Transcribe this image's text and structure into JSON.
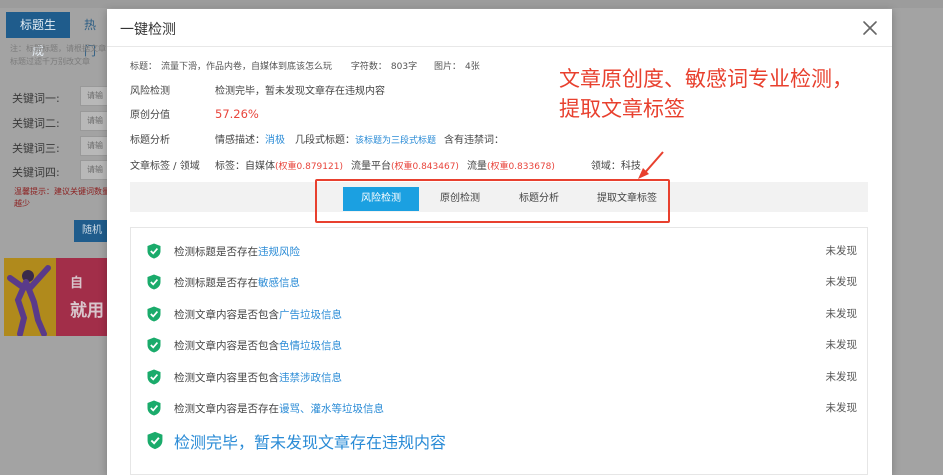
{
  "background": {
    "tabs": [
      "标题生成",
      "热门"
    ],
    "note": "注：标题标题，请根据文章标题过滤千万别改文章",
    "keywords": [
      {
        "label": "关键词一:",
        "placeholder": "请输"
      },
      {
        "label": "关键词二:",
        "placeholder": "请输"
      },
      {
        "label": "关键词三:",
        "placeholder": "请输"
      },
      {
        "label": "关键词四:",
        "placeholder": "请输"
      }
    ],
    "warning": "温馨提示：建议关键词数量越少",
    "random_button": "随机",
    "banner_lines": [
      "自",
      "就用"
    ]
  },
  "modal": {
    "title": "一键检测",
    "meta": {
      "title_label": "标题：",
      "title_value": "流量下滑，作品内卷，自媒体到底该怎么玩",
      "chars_label": "字符数：",
      "chars_value": "803字",
      "images_label": "图片：",
      "images_value": "4张"
    },
    "risk": {
      "label": "风险检测",
      "value": "检测完毕，暂未发现文章存在违规内容"
    },
    "originality": {
      "label": "原创分值",
      "value": "57.26%"
    },
    "title_analysis": {
      "label": "标题分析",
      "sentiment_label": "情感描述：",
      "sentiment_value": "消极",
      "segment_label": "几段式标题：",
      "segment_value": "该标题为三段式标题",
      "banned_label": "含有违禁词："
    },
    "tags": {
      "label": "文章标签 / 领域",
      "tag_label": "标签：",
      "tags": [
        {
          "name": "自媒体",
          "weight": "(权重0.879121)"
        },
        {
          "name": "流量平台",
          "weight": "(权重0.843467)"
        },
        {
          "name": "流量",
          "weight": "(权重0.833678)"
        }
      ],
      "domain_label": "领域：",
      "domain_value": "科技"
    },
    "overlay_lines": [
      "文章原创度、敏感词专业检测，",
      "提取文章标签"
    ],
    "tabs": [
      "风险检测",
      "原创检测",
      "标题分析",
      "提取文章标签"
    ],
    "results": [
      {
        "prefix": "检测标题是否存在",
        "highlight": "违规风险",
        "status": "未发现"
      },
      {
        "prefix": "检测标题是否存在",
        "highlight": "敏感信息",
        "status": "未发现"
      },
      {
        "prefix": "检测文章内容是否包含",
        "highlight": "广告垃圾信息",
        "status": "未发现"
      },
      {
        "prefix": "检测文章内容是否包含",
        "highlight": "色情垃圾信息",
        "status": "未发现"
      },
      {
        "prefix": "检测文章内容里否包含",
        "highlight": "违禁涉政信息",
        "status": "未发现"
      },
      {
        "prefix": "检测文章内容是否存在",
        "highlight": "谩骂、灌水等垃圾信息",
        "status": "未发现"
      }
    ],
    "final_message": "检测完毕，暂未发现文章存在违规内容"
  },
  "colors": {
    "accent": "#1ba0e1",
    "red": "#e8453c",
    "green": "#1aab6b",
    "link": "#2a8bd6"
  }
}
